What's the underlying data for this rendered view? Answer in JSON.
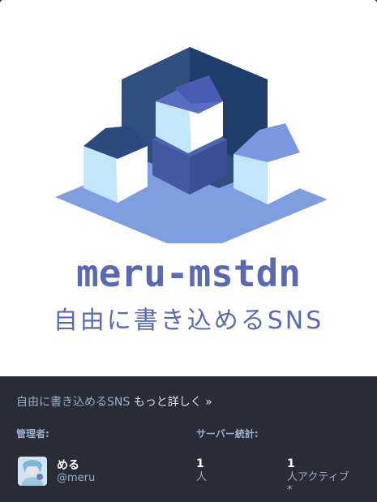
{
  "hero": {
    "title": "meru-mstdn",
    "tagline": "自由に書き込めるSNS",
    "logo_icon": "house-cluster-logo-icon"
  },
  "about": {
    "description": "自由に書き込めるSNS",
    "more_link": "もっと詳しく »"
  },
  "admin": {
    "label": "管理者:",
    "display_name": "める",
    "handle": "@meru",
    "avatar_icon": "avatar-icon"
  },
  "stats": {
    "label": "サーバー統計:",
    "users_count": "1",
    "users_label": "人",
    "active_count": "1",
    "active_label": "人アクティブ",
    "active_marker": "*"
  },
  "colors": {
    "background": "#282c37",
    "secondary_text": "#9baec8",
    "brand": "#5b6ab0"
  }
}
